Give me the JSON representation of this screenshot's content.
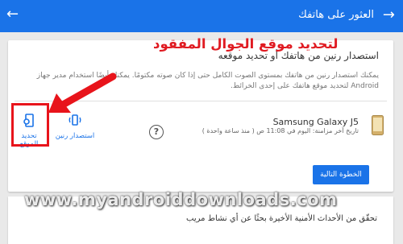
{
  "header": {
    "title": "العثور على هاتفك",
    "back_icon": "arrow-forward-icon",
    "left_icon": "arrow-back-icon",
    "color": "#1a73e8"
  },
  "card": {
    "title": "استصدار رنين من هاتفك أو تحديد موقعه",
    "description": "يمكنك استصدار رنين من هاتفك بمستوى الصوت الكامل حتى إذا كان صوته مكتومًا. يمكنك أيضًا استخدام مدير جهاز Android لتحديد موقع هاتفك على إحدى الخرائط."
  },
  "device": {
    "name": "Samsung Galaxy J5",
    "sync": "تاريخ آخر مزامنة: اليوم في 11:08 ص ( منذ ساعة واحدة )"
  },
  "actions": {
    "ring": "استصدار رنين",
    "locate": "تحديد الموقع"
  },
  "next_button": "الخطوة التالية",
  "overlay_text": "لتحديد موقع الجوال المفقود",
  "watermark": "www.myandroiddownloads.com",
  "bottom_text": "تحقّق من الأحداث الأمنية الأخيرة بحثًا عن أي نشاط مريب",
  "colors": {
    "accent": "#1a73e8",
    "annotation": "#e8141b"
  }
}
